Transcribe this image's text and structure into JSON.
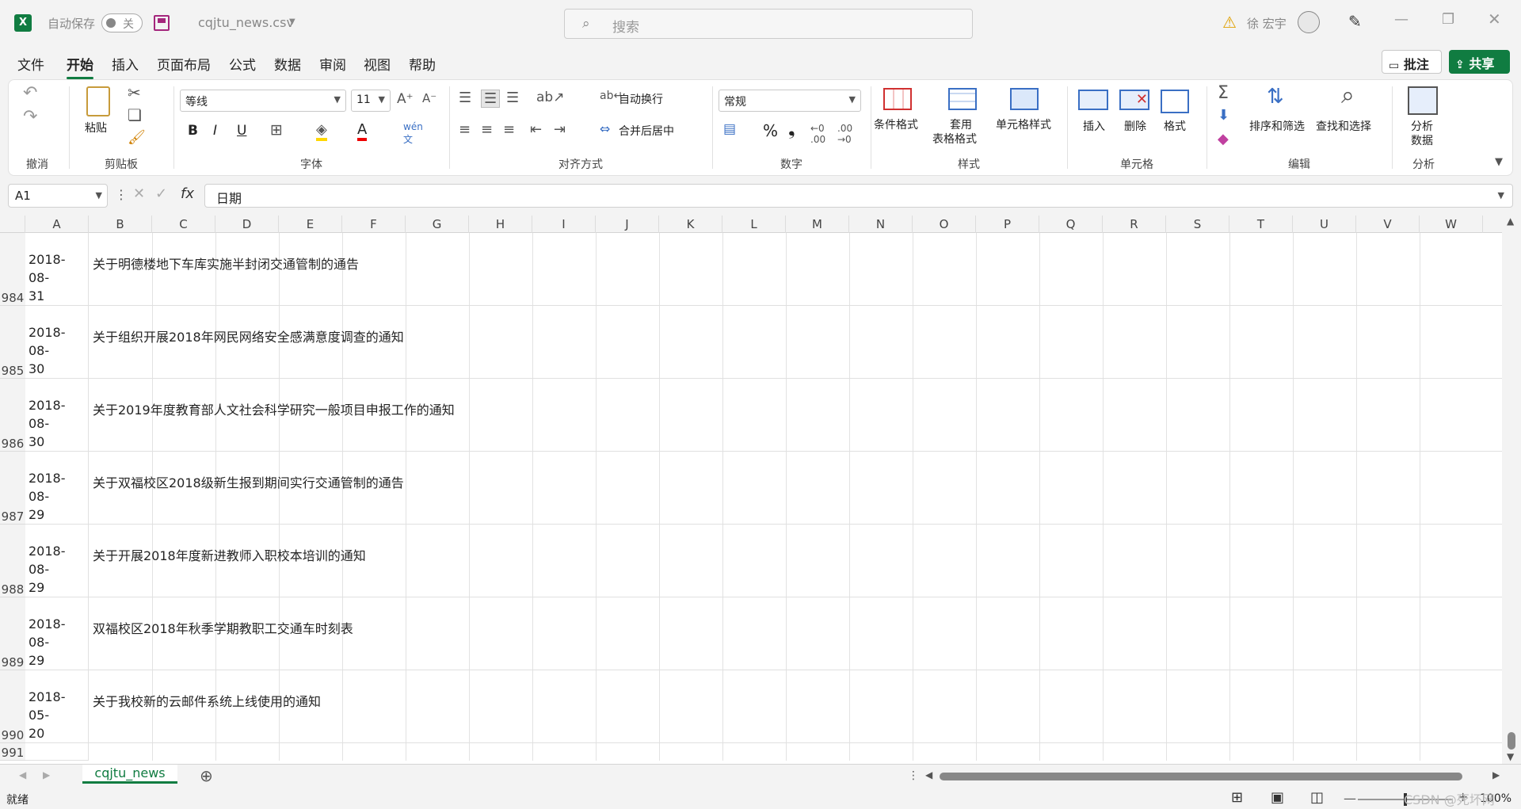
{
  "titlebar": {
    "autosave_label": "自动保存",
    "autosave_state": "关",
    "filename": "cqjtu_news.csv",
    "search_placeholder": "搜索",
    "user_name": "徐 宏宇",
    "share_label": "共享",
    "comment_label": "批注"
  },
  "menu_tabs": [
    "文件",
    "开始",
    "插入",
    "页面布局",
    "公式",
    "数据",
    "审阅",
    "视图",
    "帮助"
  ],
  "ribbon": {
    "undo_group": "撤消",
    "clipboard": {
      "paste": "粘贴",
      "group": "剪贴板"
    },
    "font": {
      "name": "等线",
      "size": "11",
      "group": "字体",
      "bold": "B",
      "italic": "I",
      "underline": "U"
    },
    "alignment": {
      "wrap": "自动换行",
      "merge": "合并后居中",
      "group": "对齐方式"
    },
    "number": {
      "format": "常规",
      "group": "数字",
      "percent": "%",
      "comma": "❟"
    },
    "styles": {
      "conditional": "条件格式",
      "table_format_1": "套用",
      "table_format_2": "表格格式",
      "cell_styles": "单元格样式",
      "group": "样式"
    },
    "cells": {
      "insert": "插入",
      "delete": "删除",
      "format": "格式",
      "group": "单元格"
    },
    "editing": {
      "sort": "排序和筛选",
      "find": "查找和选择",
      "group": "编辑"
    },
    "analysis": {
      "analyze_1": "分析",
      "analyze_2": "数据",
      "group": "分析"
    }
  },
  "formula_bar": {
    "cell_ref": "A1",
    "fx": "fx",
    "content": "日期"
  },
  "columns": [
    "A",
    "B",
    "C",
    "D",
    "E",
    "F",
    "G",
    "H",
    "I",
    "J",
    "K",
    "L",
    "M",
    "N",
    "O",
    "P",
    "Q",
    "R",
    "S",
    "T",
    "U",
    "V",
    "W"
  ],
  "rows": [
    {
      "num": "984",
      "date_1": "2018-08-",
      "date_2": "31",
      "title": "关于明德楼地下车库实施半封闭交通管制的通告"
    },
    {
      "num": "985",
      "date_1": "2018-08-",
      "date_2": "30",
      "title": "关于组织开展2018年网民网络安全感满意度调查的通知"
    },
    {
      "num": "986",
      "date_1": "2018-08-",
      "date_2": "30",
      "title": "关于2019年度教育部人文社会科学研究一般项目申报工作的通知"
    },
    {
      "num": "987",
      "date_1": "2018-08-",
      "date_2": "29",
      "title": "关于双福校区2018级新生报到期间实行交通管制的通告"
    },
    {
      "num": "988",
      "date_1": "2018-08-",
      "date_2": "29",
      "title": "关于开展2018年度新进教师入职校本培训的通知"
    },
    {
      "num": "989",
      "date_1": "2018-08-",
      "date_2": "29",
      "title": "双福校区2018年秋季学期教职工交通车时刻表"
    },
    {
      "num": "990",
      "date_1": "2018-05-",
      "date_2": "20",
      "title": "关于我校新的云邮件系统上线使用的通知"
    },
    {
      "num": "991",
      "date_1": "",
      "date_2": "",
      "title": ""
    }
  ],
  "sheet_tab": "cqjtu_news",
  "status": {
    "ready": "就绪",
    "zoom": "100%",
    "watermark": "CSDN @死坏网"
  },
  "colors": {
    "accent": "#107c41",
    "share_bg": "#107c41"
  }
}
